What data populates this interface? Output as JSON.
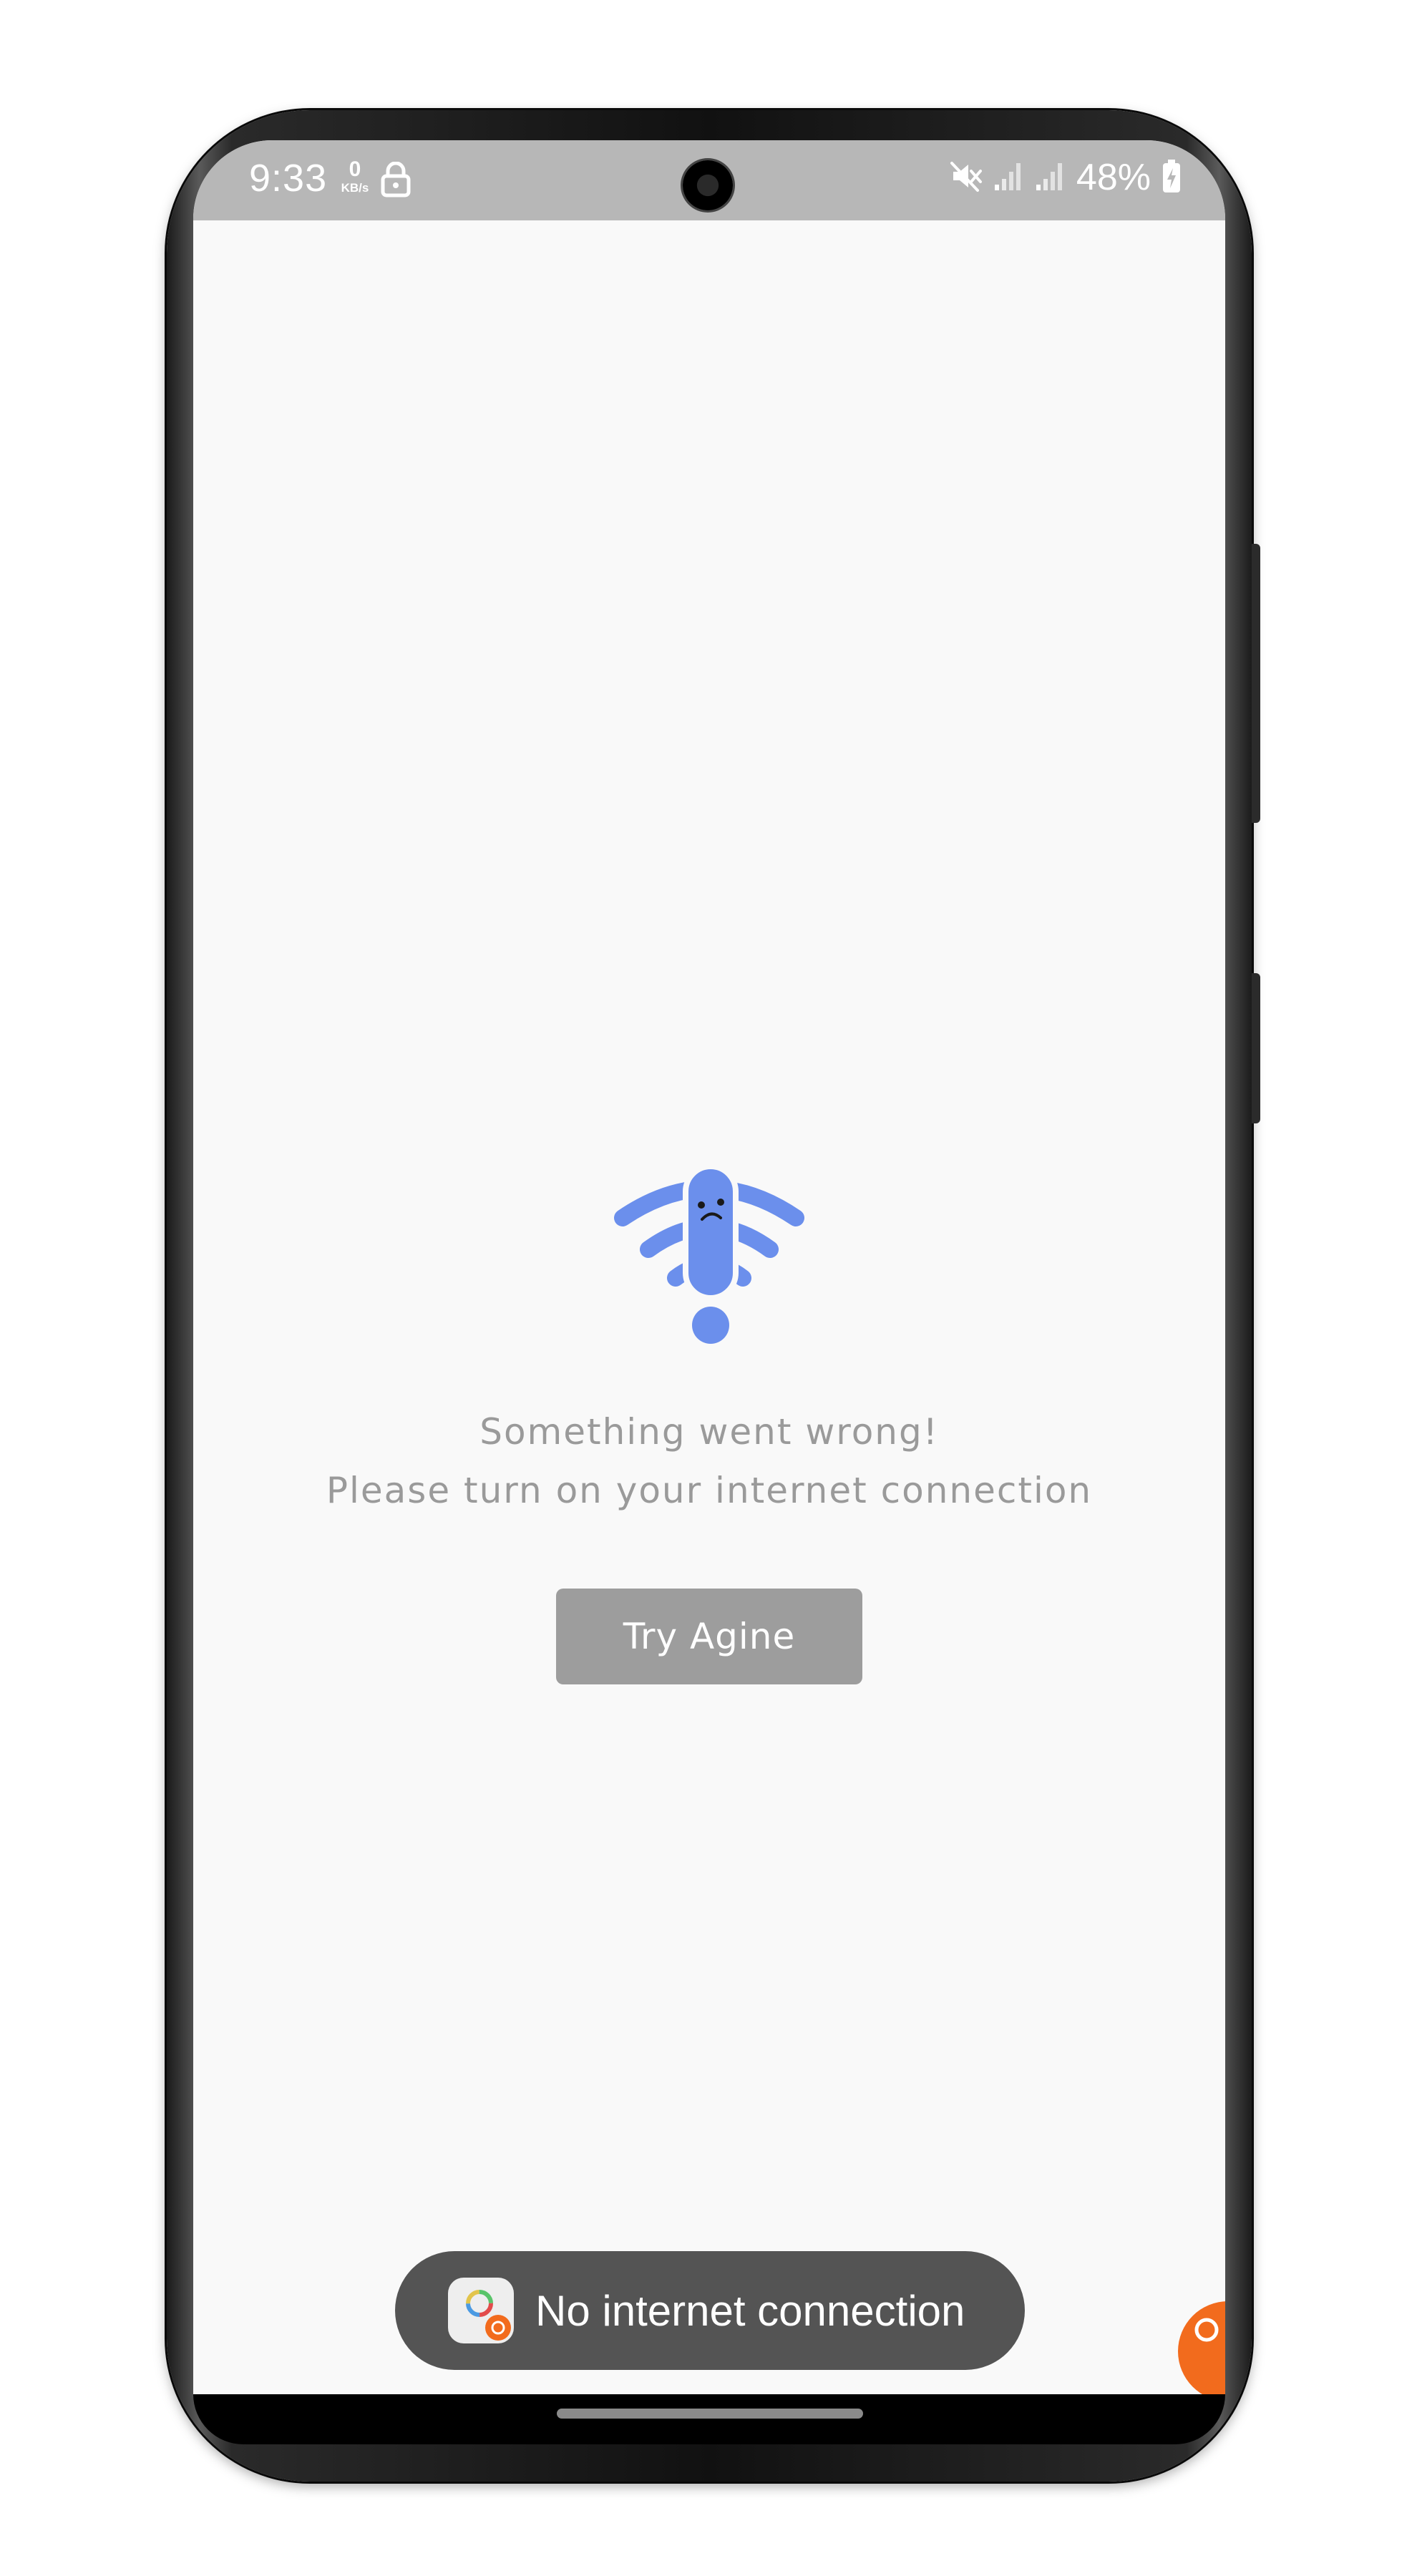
{
  "status_bar": {
    "time": "9:33",
    "net_speed_value": "0",
    "net_speed_unit": "KB/s",
    "battery_percent": "48%",
    "icons": [
      "lock-icon",
      "mute-icon",
      "signal-icon",
      "signal-icon",
      "battery-charging-icon"
    ]
  },
  "error_screen": {
    "icon": "wifi-error-icon",
    "message_line1": "Something went wrong!",
    "message_line2": "Please turn on your internet connection",
    "retry_label": "Try Agine"
  },
  "toast": {
    "icon": "app-icon",
    "text": "No internet connection"
  },
  "colors": {
    "accent": "#6b8fec",
    "button": "#9d9d9d",
    "toast_bg": "#545454",
    "message_text": "#9a9a9a",
    "status_bar_bg": "#b7b7b7",
    "floating_badge": "#f26b1d"
  }
}
